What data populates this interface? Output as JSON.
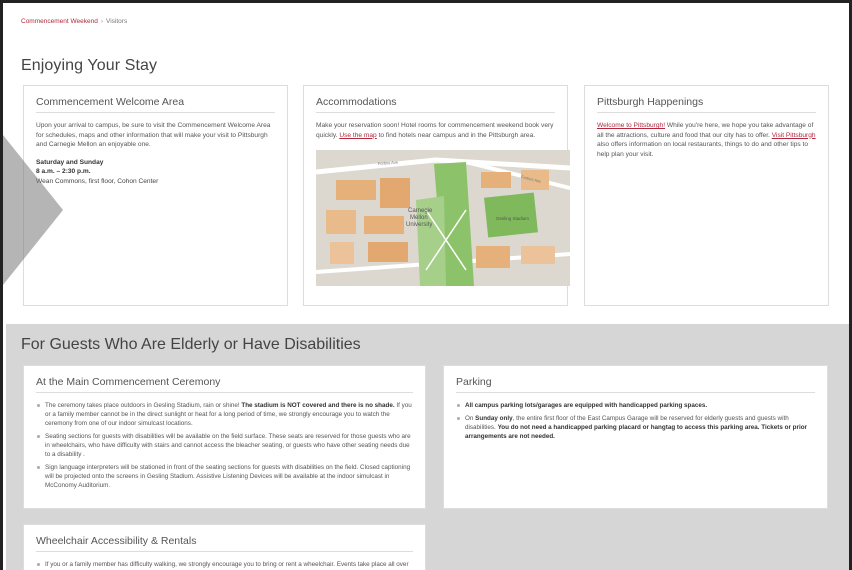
{
  "breadcrumb": {
    "parent": "Commencement Weekend",
    "separator": "›",
    "current": "Visitors"
  },
  "page_title": "Enjoying Your Stay",
  "welcome": {
    "title": "Commencement Welcome Area",
    "body": "Upon your arrival to campus, be sure to visit the Commencement Welcome Area for schedules, maps and other information that will make your visit to Pittsburgh and Carnegie Mellon an enjoyable one.",
    "days": "Saturday and Sunday",
    "time": "8 a.m. – 2:30 p.m.",
    "location": "Wean Commons, first floor, Cohon Center"
  },
  "accommodations": {
    "title": "Accommodations",
    "body_before": "Make your reservation soon! Hotel rooms for commencement weekend book very quickly.",
    "link": "Use the map",
    "body_after": "to find hotels near campus and in the Pittsburgh area.",
    "map_labels": {
      "university": "Carnegie Mellon University",
      "stadium": "Gesling Stadium",
      "street1": "Forbes Ave",
      "street2": "Forbes Ave"
    }
  },
  "happenings": {
    "title": "Pittsburgh Happenings",
    "link1": "Welcome to Pittsburgh!",
    "body1": "While you're here, we hope you take advantage of all the attractions, culture and food that our city has to offer.",
    "link2": "Visit Pittsburgh",
    "body2": "also offers information on local restaurants, things to do and other tips to help plan your visit."
  },
  "band_title": "For Guests Who Are Elderly or Have Disabilities",
  "ceremony": {
    "title": "At the Main Commencement Ceremony",
    "item1_a": "The ceremony takes place outdoors in Gesling Stadium, rain or shine!",
    "item1_b": "The stadium is NOT covered and there is no shade.",
    "item1_c": "If you or a family member cannot be in the direct sunlight or heat for a long period of time, we strongly encourage you to watch the ceremony from one of our indoor simulcast locations.",
    "item2": "Seating sections for guests with disabilities will be available on the field surface. These seats are reserved for those guests who are in wheelchairs, who have difficulty with stairs and cannot access the bleacher seating, or guests who have other seating needs due to a disability .",
    "item3": "Sign language interpreters will be stationed in front of the seating sections for guests with disabilities on the field. Closed captioning will be projected onto the screens in Gesling Stadium. Assistive Listening Devices will be available at the indoor simulcast in McConomy Auditorium."
  },
  "parking": {
    "title": "Parking",
    "item1": "All campus parking lots/garages are equipped with handicapped parking spaces.",
    "item2_a": "On",
    "item2_b": "Sunday only",
    "item2_c": ", the entire first floor of the East Campus Garage will be reserved for elderly guests and guests with disabilities.",
    "item2_d": "You do not need a handicapped parking placard or hangtag to access this parking area. Tickets or prior arrangements are not needed."
  },
  "wheelchair": {
    "title": "Wheelchair Accessibility & Rentals",
    "item1": "If you or a family member has difficulty walking, we strongly encourage you to bring or rent a wheelchair. Events take place all over campus and most campus buildings are only accessible by foot. All campus buildings are wheelchair"
  }
}
